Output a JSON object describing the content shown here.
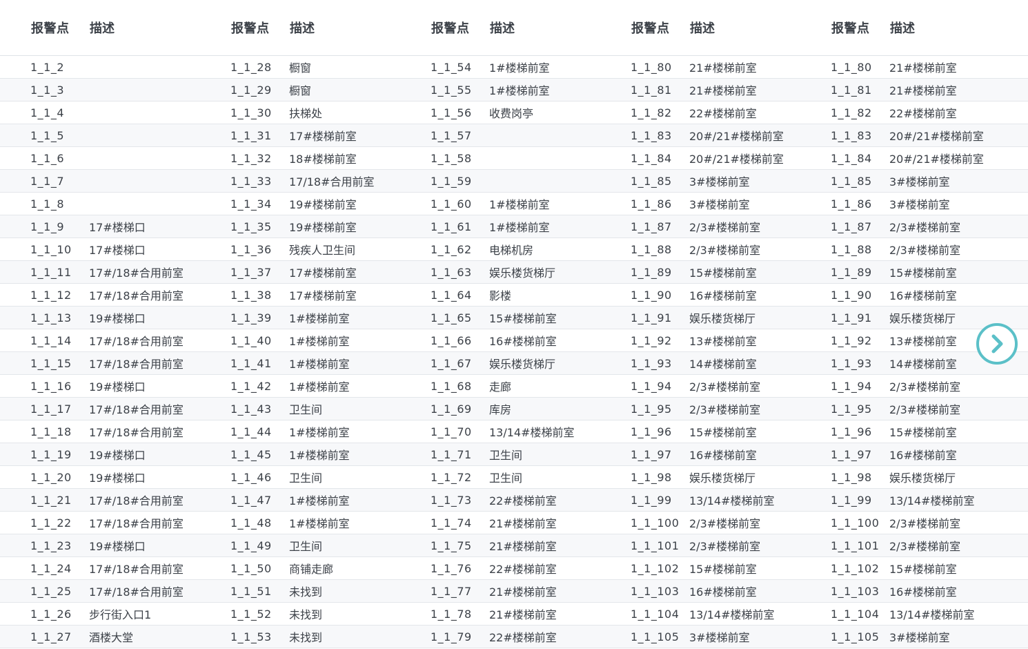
{
  "header": {
    "point_label": "报警点",
    "desc_label": "描述"
  },
  "groups": [
    {
      "rows": [
        [
          "1_1_2",
          ""
        ],
        [
          "1_1_3",
          ""
        ],
        [
          "1_1_4",
          ""
        ],
        [
          "1_1_5",
          ""
        ],
        [
          "1_1_6",
          ""
        ],
        [
          "1_1_7",
          ""
        ],
        [
          "1_1_8",
          ""
        ],
        [
          "1_1_9",
          "17#楼梯口"
        ],
        [
          "1_1_10",
          "17#楼梯口"
        ],
        [
          "1_1_11",
          "17#/18#合用前室"
        ],
        [
          "1_1_12",
          "17#/18#合用前室"
        ],
        [
          "1_1_13",
          "19#楼梯口"
        ],
        [
          "1_1_14",
          "17#/18#合用前室"
        ],
        [
          "1_1_15",
          "17#/18#合用前室"
        ],
        [
          "1_1_16",
          "19#楼梯口"
        ],
        [
          "1_1_17",
          "17#/18#合用前室"
        ],
        [
          "1_1_18",
          "17#/18#合用前室"
        ],
        [
          "1_1_19",
          "19#楼梯口"
        ],
        [
          "1_1_20",
          "19#楼梯口"
        ],
        [
          "1_1_21",
          "17#/18#合用前室"
        ],
        [
          "1_1_22",
          "17#/18#合用前室"
        ],
        [
          "1_1_23",
          "19#楼梯口"
        ],
        [
          "1_1_24",
          "17#/18#合用前室"
        ],
        [
          "1_1_25",
          "17#/18#合用前室"
        ],
        [
          "1_1_26",
          "步行街入口1"
        ],
        [
          "1_1_27",
          "酒楼大堂"
        ]
      ]
    },
    {
      "rows": [
        [
          "1_1_28",
          "橱窗"
        ],
        [
          "1_1_29",
          "橱窗"
        ],
        [
          "1_1_30",
          "扶梯处"
        ],
        [
          "1_1_31",
          "17#楼梯前室"
        ],
        [
          "1_1_32",
          "18#楼梯前室"
        ],
        [
          "1_1_33",
          "17/18#合用前室"
        ],
        [
          "1_1_34",
          "19#楼梯前室"
        ],
        [
          "1_1_35",
          "19#楼梯前室"
        ],
        [
          "1_1_36",
          "残疾人卫生间"
        ],
        [
          "1_1_37",
          "17#楼梯前室"
        ],
        [
          "1_1_38",
          "17#楼梯前室"
        ],
        [
          "1_1_39",
          "1#楼梯前室"
        ],
        [
          "1_1_40",
          "1#楼梯前室"
        ],
        [
          "1_1_41",
          "1#楼梯前室"
        ],
        [
          "1_1_42",
          "1#楼梯前室"
        ],
        [
          "1_1_43",
          "卫生间"
        ],
        [
          "1_1_44",
          "1#楼梯前室"
        ],
        [
          "1_1_45",
          "1#楼梯前室"
        ],
        [
          "1_1_46",
          "卫生间"
        ],
        [
          "1_1_47",
          "1#楼梯前室"
        ],
        [
          "1_1_48",
          "1#楼梯前室"
        ],
        [
          "1_1_49",
          "卫生间"
        ],
        [
          "1_1_50",
          "商铺走廊"
        ],
        [
          "1_1_51",
          "未找到"
        ],
        [
          "1_1_52",
          "未找到"
        ],
        [
          "1_1_53",
          "未找到"
        ]
      ]
    },
    {
      "rows": [
        [
          "1_1_54",
          "1#楼梯前室"
        ],
        [
          "1_1_55",
          "1#楼梯前室"
        ],
        [
          "1_1_56",
          "收费岗亭"
        ],
        [
          "1_1_57",
          ""
        ],
        [
          "1_1_58",
          ""
        ],
        [
          "1_1_59",
          ""
        ],
        [
          "1_1_60",
          "1#楼梯前室"
        ],
        [
          "1_1_61",
          "1#楼梯前室"
        ],
        [
          "1_1_62",
          "电梯机房"
        ],
        [
          "1_1_63",
          "娱乐楼货梯厅"
        ],
        [
          "1_1_64",
          "影楼"
        ],
        [
          "1_1_65",
          "15#楼梯前室"
        ],
        [
          "1_1_66",
          "16#楼梯前室"
        ],
        [
          "1_1_67",
          "娱乐楼货梯厅"
        ],
        [
          "1_1_68",
          "走廊"
        ],
        [
          "1_1_69",
          "库房"
        ],
        [
          "1_1_70",
          "13/14#楼梯前室"
        ],
        [
          "1_1_71",
          "卫生间"
        ],
        [
          "1_1_72",
          "卫生间"
        ],
        [
          "1_1_73",
          "22#楼梯前室"
        ],
        [
          "1_1_74",
          "21#楼梯前室"
        ],
        [
          "1_1_75",
          "21#楼梯前室"
        ],
        [
          "1_1_76",
          "22#楼梯前室"
        ],
        [
          "1_1_77",
          "21#楼梯前室"
        ],
        [
          "1_1_78",
          "21#楼梯前室"
        ],
        [
          "1_1_79",
          "22#楼梯前室"
        ]
      ]
    },
    {
      "rows": [
        [
          "1_1_80",
          "21#楼梯前室"
        ],
        [
          "1_1_81",
          "21#楼梯前室"
        ],
        [
          "1_1_82",
          "22#楼梯前室"
        ],
        [
          "1_1_83",
          "20#/21#楼梯前室"
        ],
        [
          "1_1_84",
          "20#/21#楼梯前室"
        ],
        [
          "1_1_85",
          "3#楼梯前室"
        ],
        [
          "1_1_86",
          "3#楼梯前室"
        ],
        [
          "1_1_87",
          "2/3#楼梯前室"
        ],
        [
          "1_1_88",
          "2/3#楼梯前室"
        ],
        [
          "1_1_89",
          "15#楼梯前室"
        ],
        [
          "1_1_90",
          "16#楼梯前室"
        ],
        [
          "1_1_91",
          "娱乐楼货梯厅"
        ],
        [
          "1_1_92",
          "13#楼梯前室"
        ],
        [
          "1_1_93",
          "14#楼梯前室"
        ],
        [
          "1_1_94",
          "2/3#楼梯前室"
        ],
        [
          "1_1_95",
          "2/3#楼梯前室"
        ],
        [
          "1_1_96",
          "15#楼梯前室"
        ],
        [
          "1_1_97",
          "16#楼梯前室"
        ],
        [
          "1_1_98",
          "娱乐楼货梯厅"
        ],
        [
          "1_1_99",
          "13/14#楼梯前室"
        ],
        [
          "1_1_100",
          "2/3#楼梯前室"
        ],
        [
          "1_1_101",
          "2/3#楼梯前室"
        ],
        [
          "1_1_102",
          "15#楼梯前室"
        ],
        [
          "1_1_103",
          "16#楼梯前室"
        ],
        [
          "1_1_104",
          "13/14#楼梯前室"
        ],
        [
          "1_1_105",
          "3#楼梯前室"
        ]
      ]
    },
    {
      "rows": [
        [
          "1_1_80",
          "21#楼梯前室"
        ],
        [
          "1_1_81",
          "21#楼梯前室"
        ],
        [
          "1_1_82",
          "22#楼梯前室"
        ],
        [
          "1_1_83",
          "20#/21#楼梯前室"
        ],
        [
          "1_1_84",
          "20#/21#楼梯前室"
        ],
        [
          "1_1_85",
          "3#楼梯前室"
        ],
        [
          "1_1_86",
          "3#楼梯前室"
        ],
        [
          "1_1_87",
          "2/3#楼梯前室"
        ],
        [
          "1_1_88",
          "2/3#楼梯前室"
        ],
        [
          "1_1_89",
          "15#楼梯前室"
        ],
        [
          "1_1_90",
          "16#楼梯前室"
        ],
        [
          "1_1_91",
          "娱乐楼货梯厅"
        ],
        [
          "1_1_92",
          "13#楼梯前室"
        ],
        [
          "1_1_93",
          "14#楼梯前室"
        ],
        [
          "1_1_94",
          "2/3#楼梯前室"
        ],
        [
          "1_1_95",
          "2/3#楼梯前室"
        ],
        [
          "1_1_96",
          "15#楼梯前室"
        ],
        [
          "1_1_97",
          "16#楼梯前室"
        ],
        [
          "1_1_98",
          "娱乐楼货梯厅"
        ],
        [
          "1_1_99",
          "13/14#楼梯前室"
        ],
        [
          "1_1_100",
          "2/3#楼梯前室"
        ],
        [
          "1_1_101",
          "2/3#楼梯前室"
        ],
        [
          "1_1_102",
          "15#楼梯前室"
        ],
        [
          "1_1_103",
          "16#楼梯前室"
        ],
        [
          "1_1_104",
          "13/14#楼梯前室"
        ],
        [
          "1_1_105",
          "3#楼梯前室"
        ]
      ]
    }
  ],
  "next_button": {
    "icon": "chevron-right-icon",
    "color": "#5bc0c8"
  }
}
